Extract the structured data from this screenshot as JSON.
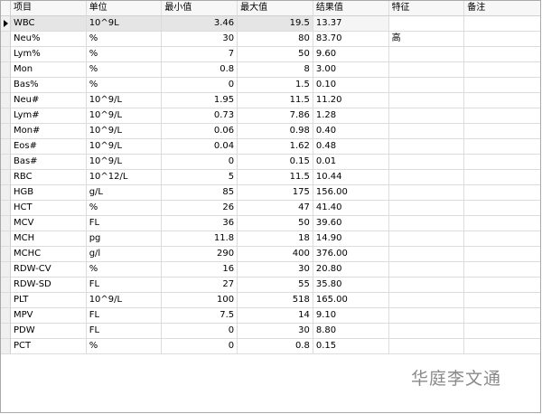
{
  "columns": [
    "项目",
    "单位",
    "最小值",
    "最大值",
    "结果值",
    "特征",
    "备注"
  ],
  "rows": [
    [
      "WBC",
      "10^9L",
      "3.46",
      "19.5",
      "13.37",
      "",
      ""
    ],
    [
      "Neu%",
      "%",
      "30",
      "80",
      "83.70",
      "高",
      ""
    ],
    [
      "Lym%",
      "%",
      "7",
      "50",
      "9.60",
      "",
      ""
    ],
    [
      "Mon",
      "%",
      "0.8",
      "8",
      "3.00",
      "",
      ""
    ],
    [
      "Bas%",
      "%",
      "0",
      "1.5",
      "0.10",
      "",
      ""
    ],
    [
      "Neu#",
      "10^9/L",
      "1.95",
      "11.5",
      "11.20",
      "",
      ""
    ],
    [
      "Lym#",
      "10^9/L",
      "0.73",
      "7.86",
      "1.28",
      "",
      ""
    ],
    [
      "Mon#",
      "10^9/L",
      "0.06",
      "0.98",
      "0.40",
      "",
      ""
    ],
    [
      "Eos#",
      "10^9/L",
      "0.04",
      "1.62",
      "0.48",
      "",
      ""
    ],
    [
      "Bas#",
      "10^9/L",
      "0",
      "0.15",
      "0.01",
      "",
      ""
    ],
    [
      "RBC",
      "10^12/L",
      "5",
      "11.5",
      "10.44",
      "",
      ""
    ],
    [
      "HGB",
      "g/L",
      "85",
      "175",
      "156.00",
      "",
      ""
    ],
    [
      "HCT",
      "%",
      "26",
      "47",
      "41.40",
      "",
      ""
    ],
    [
      "MCV",
      "FL",
      "36",
      "50",
      "39.60",
      "",
      ""
    ],
    [
      "MCH",
      "pg",
      "11.8",
      "18",
      "14.90",
      "",
      ""
    ],
    [
      "MCHC",
      "g/l",
      "290",
      "400",
      "376.00",
      "",
      ""
    ],
    [
      "RDW-CV",
      "%",
      "16",
      "30",
      "20.80",
      "",
      ""
    ],
    [
      "RDW-SD",
      "FL",
      "27",
      "55",
      "35.80",
      "",
      ""
    ],
    [
      "PLT",
      "10^9/L",
      "100",
      "518",
      "165.00",
      "",
      ""
    ],
    [
      "MPV",
      "FL",
      "7.5",
      "14",
      "9.10",
      "",
      ""
    ],
    [
      "PDW",
      "FL",
      "0",
      "30",
      "8.80",
      "",
      ""
    ],
    [
      "PCT",
      "%",
      "0",
      "0.8",
      "0.15",
      "",
      ""
    ]
  ],
  "current_row_index": 0,
  "watermark": "华庭李文通"
}
